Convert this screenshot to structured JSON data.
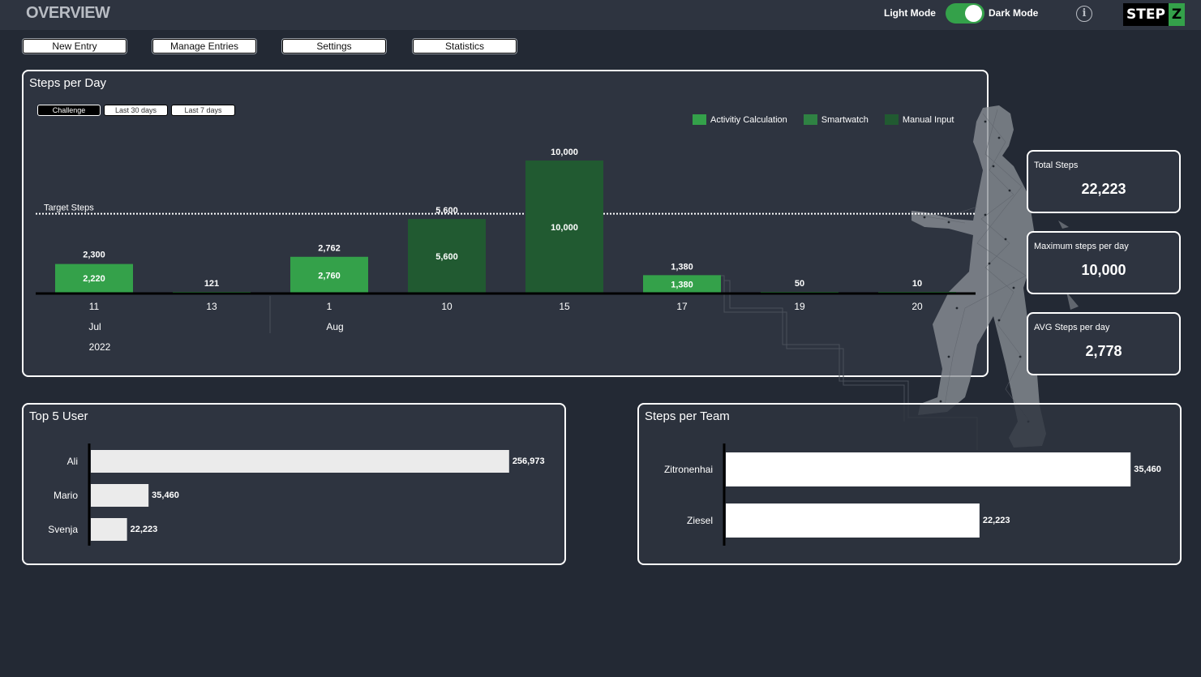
{
  "header": {
    "title": "OVERVIEW",
    "light_mode_label": "Light Mode",
    "dark_mode_label": "Dark Mode",
    "dark_mode_enabled": true,
    "info_icon": "info-icon",
    "logo": {
      "part1": "STEP",
      "part2": "Z"
    }
  },
  "nav": {
    "buttons": [
      "New Entry",
      "Manage Entries",
      "Settings",
      "Statistics"
    ]
  },
  "colors": {
    "accent": "#34a14a",
    "activity_calculation": "#34a14a",
    "smartwatch": "#2f8243",
    "manual_input": "#215a31",
    "panel_bg": "#2e3440",
    "page_bg": "#232934"
  },
  "steps_per_day": {
    "title": "Steps per Day",
    "filters": [
      {
        "label": "Challenge",
        "active": true
      },
      {
        "label": "Last 30 days",
        "active": false
      },
      {
        "label": "Last 7 days",
        "active": false
      }
    ],
    "legend": [
      "Activitiy Calculation",
      "Smartwatch",
      "Manual Input"
    ],
    "target_label": "Target Steps"
  },
  "kpis": [
    {
      "label": "Total Steps",
      "value": "22,223"
    },
    {
      "label": "Maximum steps per day",
      "value": "10,000"
    },
    {
      "label": "AVG Steps per day",
      "value": "2,778"
    }
  ],
  "top_users": {
    "title": "Top 5 User"
  },
  "steps_per_team": {
    "title": "Steps per Team"
  },
  "chart_data": [
    {
      "type": "bar",
      "title": "Steps per Day",
      "xlabel": "",
      "ylabel": "",
      "categories": [
        "11",
        "13",
        "1",
        "10",
        "15",
        "17",
        "19",
        "20"
      ],
      "category_groups": [
        {
          "label": "Jul",
          "year": "2022",
          "days": [
            "11",
            "13"
          ]
        },
        {
          "label": "Aug",
          "year": "",
          "days": [
            "1",
            "10",
            "15",
            "17",
            "19",
            "20"
          ]
        }
      ],
      "series": [
        {
          "name": "Manual Input",
          "color_key": "manual_input",
          "values": [
            0,
            0,
            0,
            5600,
            10000,
            0,
            0,
            0
          ]
        },
        {
          "name": "Activitiy Calculation",
          "color_key": "activity_calculation",
          "values": [
            2220,
            121,
            2760,
            0,
            0,
            1380,
            50,
            10
          ]
        }
      ],
      "inner_labels": [
        "2,220",
        "",
        "2,760",
        "5,600",
        "10,000",
        "1,380",
        "",
        ""
      ],
      "total_labels": [
        "2,300",
        "121",
        "2,762",
        "5,600",
        "10,000",
        "1,380",
        "50",
        "10"
      ],
      "totals": [
        2300,
        121,
        2762,
        5600,
        10000,
        1380,
        50,
        10
      ],
      "target": 6000,
      "target_label": "Target Steps",
      "ylim": [
        0,
        11000
      ],
      "legend": [
        "Activitiy Calculation",
        "Smartwatch",
        "Manual Input"
      ],
      "legend_position": "top-right",
      "grid": false
    },
    {
      "type": "bar",
      "orientation": "horizontal",
      "title": "Top 5 User",
      "categories": [
        "Ali",
        "Mario",
        "Svenja"
      ],
      "values": [
        256973,
        35460,
        22223
      ],
      "labels": [
        "256,973",
        "35,460",
        "22,223"
      ],
      "xlim": [
        0,
        275000
      ]
    },
    {
      "type": "bar",
      "orientation": "horizontal",
      "title": "Steps per Team",
      "categories": [
        "Zitronenhai",
        "Ziesel"
      ],
      "values": [
        35460,
        22223
      ],
      "labels": [
        "35,460",
        "22,223"
      ],
      "xlim": [
        0,
        38500
      ]
    }
  ]
}
